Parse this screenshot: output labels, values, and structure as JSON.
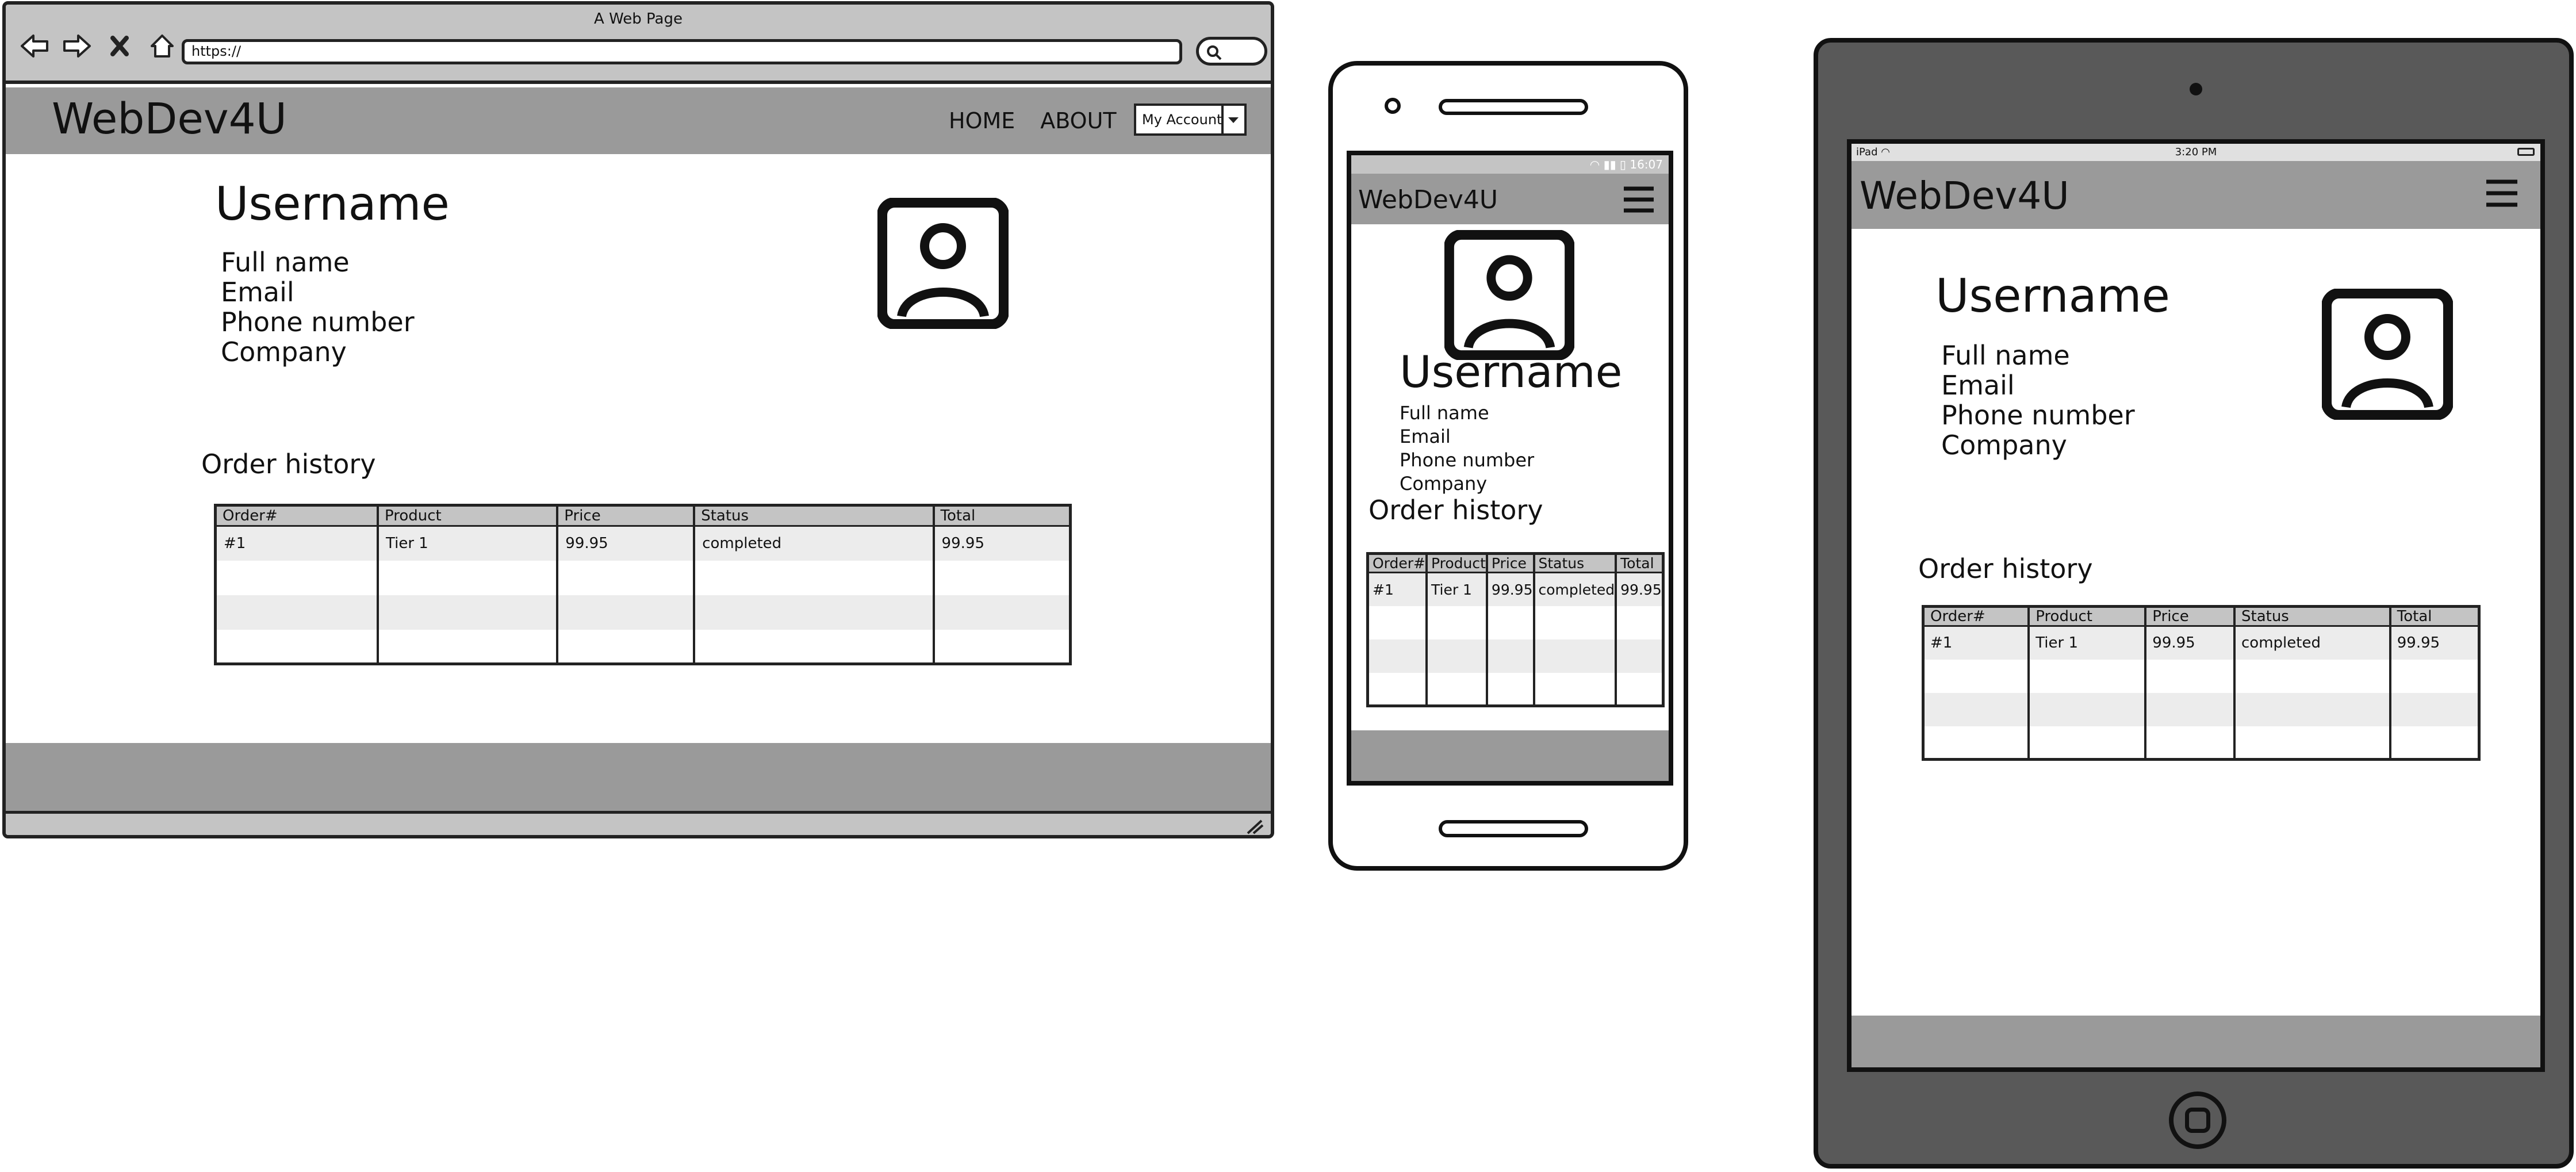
{
  "desktop": {
    "window_title": "A Web Page",
    "url": "https://",
    "site_title": "WebDev4U",
    "nav": [
      "HOME",
      "ABOUT"
    ],
    "account_label": "My Account",
    "username": "Username",
    "fields": [
      "Full name",
      "Email",
      "Phone number",
      "Company"
    ],
    "order_history_title": "Order history",
    "icons": [
      "back-arrow-icon",
      "forward-arrow-icon",
      "stop-icon",
      "home-icon",
      "search-icon",
      "user-avatar-icon",
      "resize-grip-icon"
    ]
  },
  "phone": {
    "status_time": "16:07",
    "site_title": "WebDev4U",
    "username": "Username",
    "fields": [
      "Full name",
      "Email",
      "Phone number",
      "Company"
    ],
    "order_history_title": "Order history",
    "icons": [
      "hamburger-menu-icon",
      "user-avatar-icon",
      "wifi-icon",
      "signal-icon",
      "battery-icon"
    ]
  },
  "tablet": {
    "status_device": "iPad",
    "status_time": "3:20 PM",
    "site_title": "WebDev4U",
    "username": "Username",
    "fields": [
      "Full name",
      "Email",
      "Phone number",
      "Company"
    ],
    "order_history_title": "Order history",
    "icons": [
      "hamburger-menu-icon",
      "user-avatar-icon",
      "wifi-icon",
      "battery-icon"
    ]
  },
  "orders": {
    "columns": [
      "Order#",
      "Product",
      "Price",
      "Status",
      "Total"
    ],
    "rows": [
      [
        "#1",
        "Tier 1",
        "99.95",
        "completed",
        "99.95"
      ],
      [
        "",
        "",
        "",
        "",
        ""
      ],
      [
        "",
        "",
        "",
        "",
        ""
      ],
      [
        "",
        "",
        "",
        "",
        ""
      ]
    ]
  },
  "colors": {
    "header_gray": "#9a9a9a",
    "chrome_gray": "#c4c4c4",
    "tablet_body": "#595959",
    "row_alt": "#ececec"
  }
}
